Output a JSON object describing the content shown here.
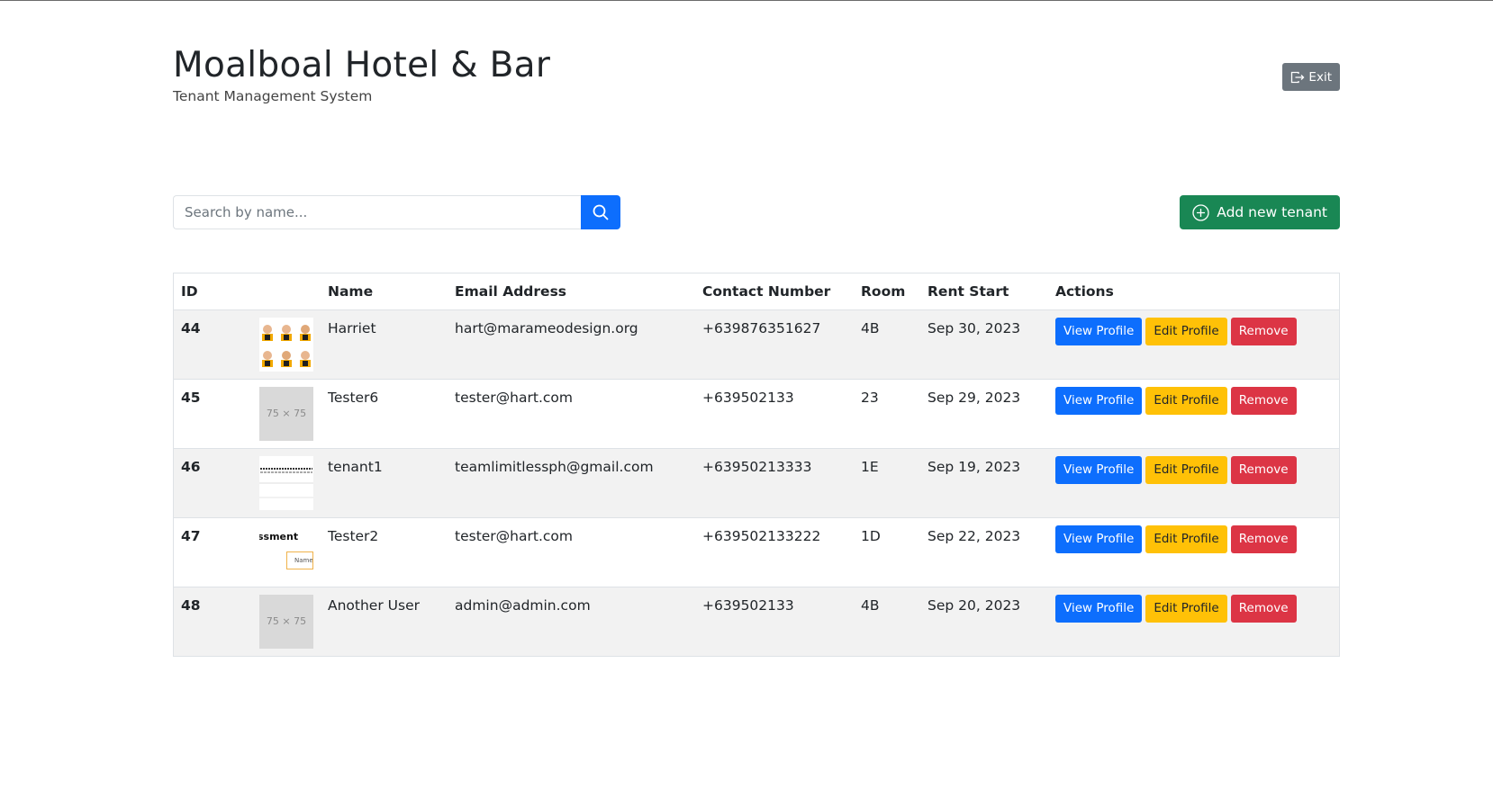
{
  "header": {
    "title": "Moalboal Hotel & Bar",
    "subtitle": "Tenant Management System",
    "exit_label": "Exit"
  },
  "search": {
    "placeholder": "Search by name...",
    "value": ""
  },
  "add_button_label": "Add new tenant",
  "table": {
    "columns": [
      "ID",
      "",
      "Name",
      "Email Address",
      "Contact Number",
      "Room",
      "Rent Start",
      "Actions"
    ],
    "rows": [
      {
        "id": "44",
        "photo": "photo-grid",
        "photo_text": "",
        "name": "Harriet",
        "email": "hart@marameodesign.org",
        "contact": "+639876351627",
        "room": "4B",
        "rent_start": "Sep 30, 2023"
      },
      {
        "id": "45",
        "photo": "placeholder",
        "photo_text": "75 × 75",
        "name": "Tester6",
        "email": "tester@hart.com",
        "contact": "+639502133",
        "room": "23",
        "rent_start": "Sep 29, 2023"
      },
      {
        "id": "46",
        "photo": "document",
        "photo_text": "",
        "name": "tenant1",
        "email": "teamlimitlessph@gmail.com",
        "contact": "+63950213333",
        "room": "1E",
        "rent_start": "Sep 19, 2023"
      },
      {
        "id": "47",
        "photo": "form",
        "photo_text": "ssment",
        "photo_text2": "Name",
        "name": "Tester2",
        "email": "tester@hart.com",
        "contact": "+639502133222",
        "room": "1D",
        "rent_start": "Sep 22, 2023"
      },
      {
        "id": "48",
        "photo": "placeholder",
        "photo_text": "75 × 75",
        "name": "Another User",
        "email": "admin@admin.com",
        "contact": "+639502133",
        "room": "4B",
        "rent_start": "Sep 20, 2023"
      }
    ],
    "actions": {
      "view": "View Profile",
      "edit": "Edit Profile",
      "remove": "Remove"
    }
  },
  "colors": {
    "primary": "#0d6efd",
    "success": "#198754",
    "warning": "#ffc107",
    "danger": "#dc3545",
    "secondary": "#6c757d"
  }
}
